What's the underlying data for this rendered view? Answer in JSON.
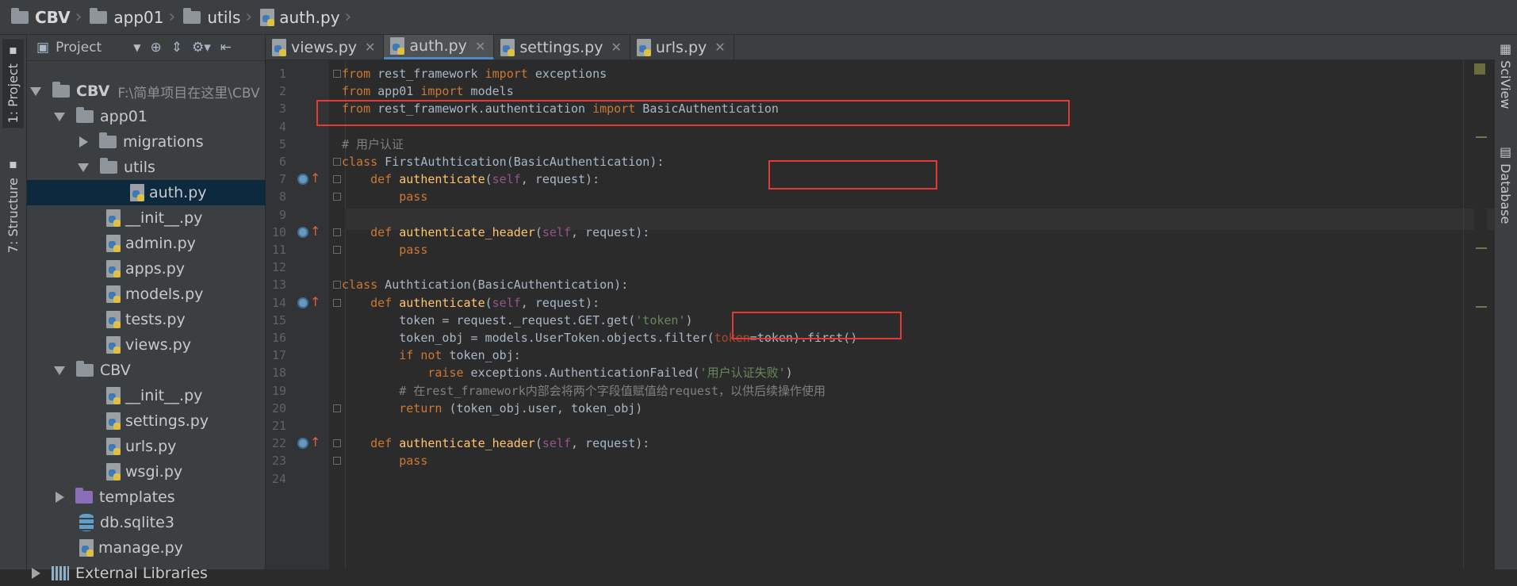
{
  "breadcrumb": {
    "items": [
      "CBV",
      "app01",
      "utils",
      "auth.py"
    ]
  },
  "left_strip": {
    "project_tab": "1: Project",
    "structure_tab": "7: Structure"
  },
  "right_strip": {
    "sciview_tab": "SciView",
    "database_tab": "Database"
  },
  "project_panel": {
    "title": "Project",
    "tree": [
      {
        "label": "CBV",
        "path": "F:\\简单项目在这里\\CBV"
      },
      {
        "label": "app01"
      },
      {
        "label": "migrations"
      },
      {
        "label": "utils"
      },
      {
        "label": "auth.py"
      },
      {
        "label": "__init__.py"
      },
      {
        "label": "admin.py"
      },
      {
        "label": "apps.py"
      },
      {
        "label": "models.py"
      },
      {
        "label": "tests.py"
      },
      {
        "label": "views.py"
      },
      {
        "label": "CBV"
      },
      {
        "label": "__init__.py"
      },
      {
        "label": "settings.py"
      },
      {
        "label": "urls.py"
      },
      {
        "label": "wsgi.py"
      },
      {
        "label": "templates"
      },
      {
        "label": "db.sqlite3"
      },
      {
        "label": "manage.py"
      },
      {
        "label": "External Libraries"
      }
    ]
  },
  "tabs": [
    {
      "label": "views.py"
    },
    {
      "label": "auth.py",
      "active": true
    },
    {
      "label": "settings.py"
    },
    {
      "label": "urls.py"
    }
  ],
  "editor": {
    "line_numbers": [
      "1",
      "2",
      "3",
      "4",
      "5",
      "6",
      "7",
      "8",
      "9",
      "10",
      "11",
      "12",
      "13",
      "14",
      "15",
      "16",
      "17",
      "18",
      "19",
      "20",
      "21",
      "22",
      "23",
      "24"
    ],
    "lines": [
      "from rest_framework import exceptions",
      "from app01 import models",
      "from rest_framework.authentication import BasicAuthentication",
      "",
      "# 用户认证",
      "class FirstAuthtication(BasicAuthentication):",
      "    def authenticate(self, request):",
      "        pass",
      "",
      "    def authenticate_header(self, request):",
      "        pass",
      "",
      "class Authtication(BasicAuthentication):",
      "    def authenticate(self, request):",
      "        token = request._request.GET.get('token')",
      "        token_obj = models.UserToken.objects.filter(token=token).first()",
      "        if not token_obj:",
      "            raise exceptions.AuthenticationFailed('用户认证失败')",
      "        # 在rest_framework内部会将两个字段值赋值给request，以供后续操作使用",
      "        return (token_obj.user, token_obj)",
      "",
      "    def authenticate_header(self, request):",
      "        pass",
      ""
    ]
  },
  "colors": {
    "keyword": "#cc7832",
    "function": "#ffc66d",
    "self": "#94558d",
    "string": "#6a8759",
    "comment": "#808080",
    "highlight": "#e53935"
  }
}
